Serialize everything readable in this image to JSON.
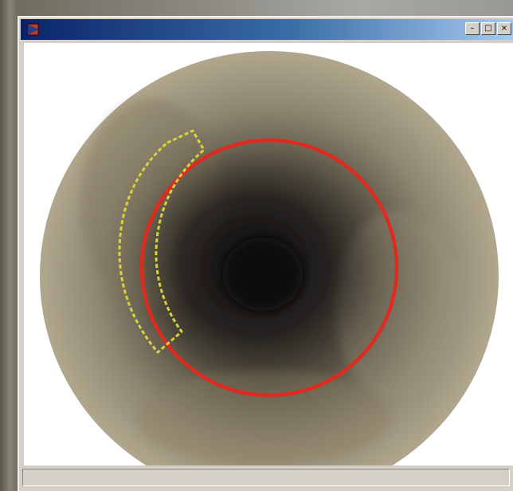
{
  "window": {
    "title": "",
    "controls": {
      "minimize_glyph": "–",
      "maximize_glyph": "□",
      "close_glyph": "×"
    }
  },
  "viewer": {
    "image_description_colors": {
      "frame_background": "#ffffff",
      "outer_wall": "#a49a80",
      "tunnel_center": "#0e0c10",
      "detected_circle": "#e02a20",
      "region_outline": "#d9d23a"
    }
  },
  "statusbar": {
    "text": ""
  },
  "colors": {
    "titlebar_start": "#0a246a",
    "titlebar_end": "#a6caf0",
    "window_face": "#d4d0c8"
  }
}
